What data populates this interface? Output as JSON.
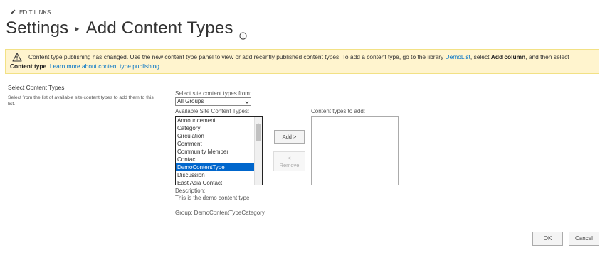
{
  "edit_links": {
    "label": "EDIT LINKS"
  },
  "title": {
    "parent": "Settings",
    "current": "Add Content Types"
  },
  "warning": {
    "text_1": "Content type publishing has changed. Use the new content type panel to view or add recently published content types. To add a content type, go to the library ",
    "link_library": "DemoList",
    "text_2": ", select ",
    "bold_1": "Add column",
    "text_3": ", and then select ",
    "bold_2": "Content type",
    "text_4": ". ",
    "link_learn": "Learn more about content type publishing"
  },
  "section": {
    "title": "Select Content Types",
    "description": "Select from the list of available site content types to add them to this list."
  },
  "select_from": {
    "label": "Select site content types from:",
    "value": "All Groups"
  },
  "available": {
    "label": "Available Site Content Types:",
    "items": [
      "Announcement",
      "Category",
      "Circulation",
      "Comment",
      "Community Member",
      "Contact",
      "DemoContentType",
      "Discussion",
      "East Asia Contact"
    ],
    "selected": "DemoContentType"
  },
  "buttons": {
    "add": "Add >",
    "remove_arrow": "<",
    "remove": "Remove",
    "ok": "OK",
    "cancel": "Cancel"
  },
  "to_add": {
    "label": "Content types to add:",
    "items": []
  },
  "description": {
    "label": "Description:",
    "value": "This is the demo content type"
  },
  "group": {
    "value": "Group: DemoContentTypeCategory"
  },
  "colors": {
    "selection": "#0066cc",
    "warning_bg": "#fff4ce",
    "link": "#0072c6"
  }
}
